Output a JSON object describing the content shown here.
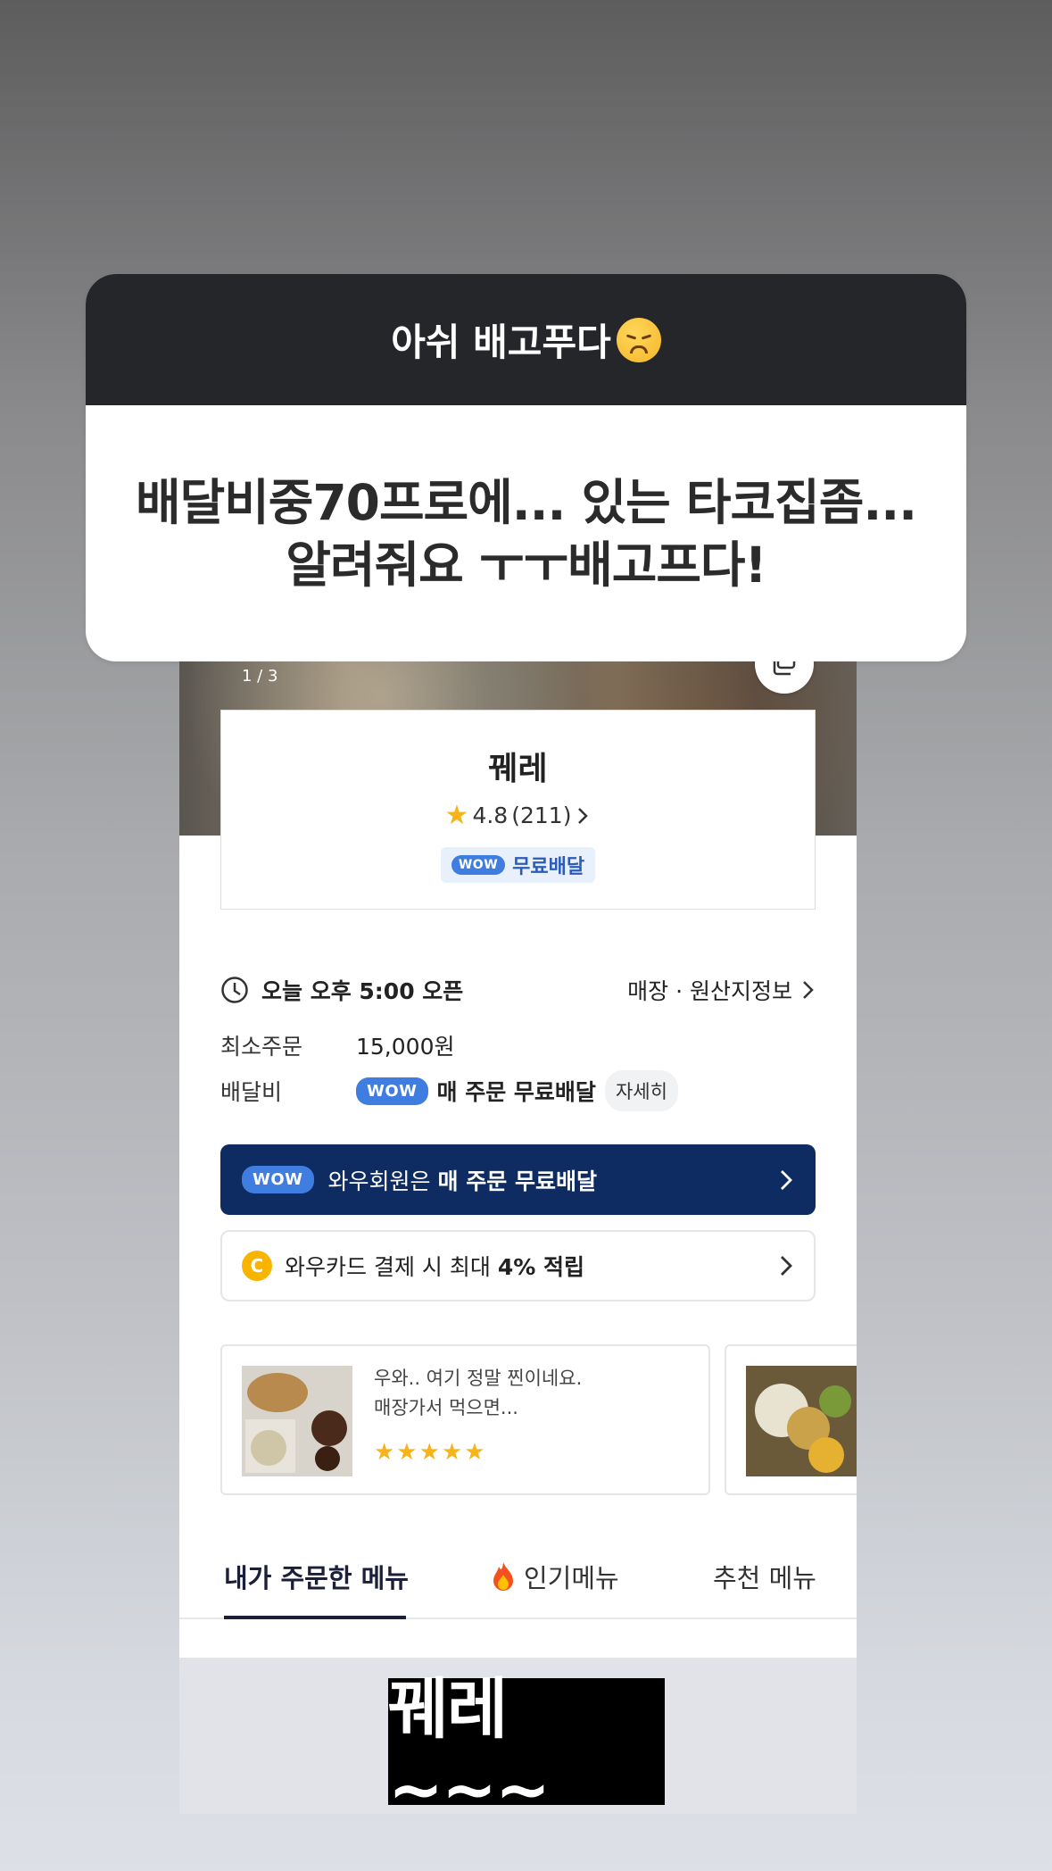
{
  "question": {
    "title": "아쉬 배고푸다",
    "title_emoji": "disappointed-face",
    "answer_line1": "배달비중70프로에... 있는 타코집좀...",
    "answer_line2": "알려줘요 ㅜㅜ배고프다!"
  },
  "app": {
    "pager": "1 / 3",
    "store_name": "꿰레",
    "rating": "4.8",
    "review_count": "(211)",
    "wow_badge": "WOW",
    "free_delivery": "무료배달",
    "open_time": "오늘 오후 5:00 오픈",
    "store_info_link": "매장 · 원산지정보",
    "min_order_label": "최소주문",
    "min_order_value": "15,000원",
    "delivery_fee_label": "배달비",
    "delivery_fee_value": "매 주문 무료배달",
    "detail_chip": "자세히",
    "wow_banner_prefix": "와우회원은 ",
    "wow_banner_bold": "매 주문 무료배달",
    "card_banner_prefix": "와우카드 결제 시 최대 ",
    "card_banner_bold": "4% 적립",
    "coin_letter": "C",
    "review_line1": "우와.. 여기 정말 찐이네요.",
    "review_line2": "매장가서 먹으면...",
    "review_stars": "★★★★★",
    "review_rating": 5,
    "tabs": [
      {
        "label": "내가 주문한 메뉴"
      },
      {
        "label": "인기메뉴"
      },
      {
        "label": "추천 메뉴"
      }
    ]
  },
  "sticker_text": "꿰레~~~",
  "colors": {
    "question_header": "#24262a",
    "wow_banner": "#0f2c62",
    "wow_pill": "#3f7de0",
    "star": "#f6b41a",
    "coin": "#f7b500"
  }
}
